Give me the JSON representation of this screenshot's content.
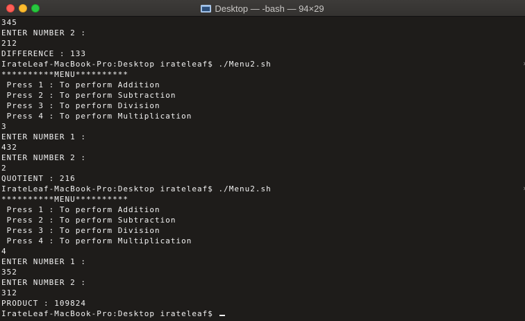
{
  "window": {
    "title": "Desktop — -bash — 94×29",
    "colors": {
      "close": "#fe5f57",
      "minimize": "#febc2e",
      "zoom": "#28c840",
      "background": "#1e1c1a",
      "text": "#f2f2f2"
    },
    "title_icon": "folder-icon"
  },
  "terminal": {
    "lines": [
      "345",
      "ENTER NUMBER 2 :",
      "212",
      "DIFFERENCE : 133",
      "IrateLeaf-MacBook-Pro:Desktop irateleaf$ ./Menu2.sh",
      "**********MENU**********",
      " Press 1 : To perform Addition",
      " Press 2 : To perform Subtraction",
      " Press 3 : To perform Division",
      " Press 4 : To perform Multiplication",
      "3",
      "ENTER NUMBER 1 :",
      "432",
      "ENTER NUMBER 2 :",
      "2",
      "QUOTIENT : 216",
      "IrateLeaf-MacBook-Pro:Desktop irateleaf$ ./Menu2.sh",
      "**********MENU**********",
      " Press 1 : To perform Addition",
      " Press 2 : To perform Subtraction",
      " Press 3 : To perform Division",
      " Press 4 : To perform Multiplication",
      "4",
      "ENTER NUMBER 1 :",
      "352",
      "ENTER NUMBER 2 :",
      "312",
      "PRODUCT : 109824",
      "IrateLeaf-MacBook-Pro:Desktop irateleaf$ "
    ]
  }
}
